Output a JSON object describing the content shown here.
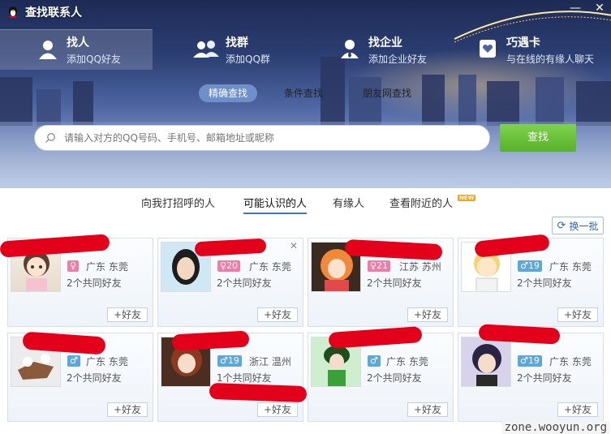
{
  "window": {
    "title": "查找联系人"
  },
  "top_tabs": [
    {
      "title": "找人",
      "subtitle": "添加QQ好友",
      "icon": "person-icon"
    },
    {
      "title": "找群",
      "subtitle": "添加QQ群",
      "icon": "group-icon"
    },
    {
      "title": "找企业",
      "subtitle": "添加企业好友",
      "icon": "business-person-icon"
    },
    {
      "title": "巧遇卡",
      "subtitle": "与在线的有缘人聊天",
      "icon": "heart-card-icon"
    }
  ],
  "search_modes": [
    "精确查找",
    "条件查找",
    "朋友网查找"
  ],
  "search": {
    "placeholder": "请输入对方的QQ号码、手机号、邮箱地址或昵称",
    "button": "查找"
  },
  "sub_tabs": [
    "向我打招呼的人",
    "可能认识的人",
    "有缘人",
    "查看附近的人"
  ],
  "new_badge": "NEW",
  "refresh_label": "换一批",
  "add_label": "+好友",
  "cards": [
    {
      "gender": "f",
      "age": "",
      "location": "广东  东莞",
      "mutual": "2个共同好友"
    },
    {
      "gender": "f",
      "age": "20",
      "location": "广东  东莞",
      "mutual": "2个共同好友"
    },
    {
      "gender": "f",
      "age": "21",
      "location": "江苏  苏州",
      "mutual": "2个共同好友"
    },
    {
      "gender": "m",
      "age": "19",
      "location": "广东  东莞",
      "mutual": "2个共同好友"
    },
    {
      "gender": "m",
      "age": "",
      "location": "广东  东莞",
      "mutual": "2个共同好友"
    },
    {
      "gender": "m",
      "age": "19",
      "location": "浙江  温州",
      "mutual": "1个共同好友"
    },
    {
      "gender": "m",
      "age": "",
      "location": "广东  东莞",
      "mutual": "2个共同好友"
    },
    {
      "gender": "m",
      "age": "19",
      "location": "广东  东莞",
      "mutual": "2个共同好友"
    }
  ],
  "watermark": "zone.wooyun.org",
  "colors": {
    "accent_blue": "#3a78c4",
    "search_green": "#58b22c",
    "female": "#f07ca8",
    "male": "#5ca8dc",
    "redact": "#e2001a"
  }
}
